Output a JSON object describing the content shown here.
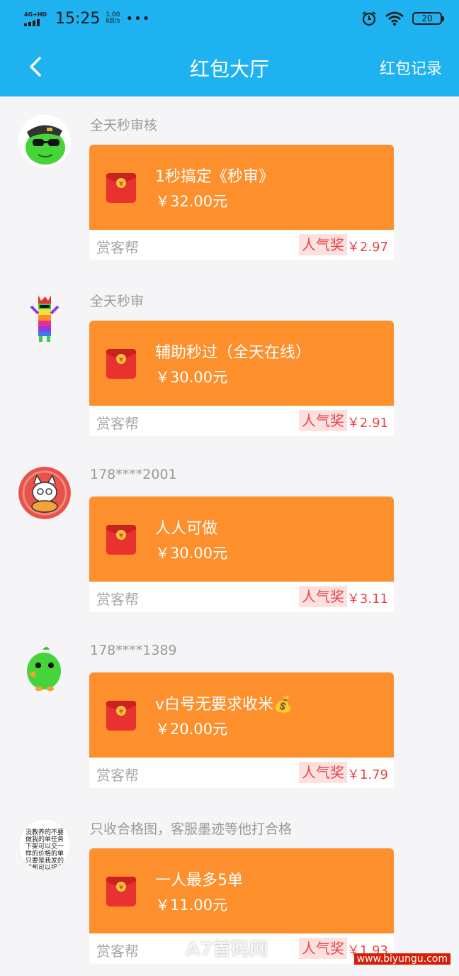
{
  "status_bar": {
    "network": "4G+HD",
    "time": "15:25",
    "speed_value": "1.00",
    "speed_unit": "KB/s",
    "more": "•••",
    "battery": "20"
  },
  "nav": {
    "title": "红包大厅",
    "record_label": "红包记录"
  },
  "items": [
    {
      "sender": "全天秒审核",
      "title": "1秒搞定《秒审》",
      "amount": "￥32.00元",
      "source": "赏客帮",
      "tag": "人气奖",
      "bonus": "￥2.97"
    },
    {
      "sender": "全天秒审",
      "title": "辅助秒过（全天在线）",
      "amount": "￥30.00元",
      "source": "赏客帮",
      "tag": "人气奖",
      "bonus": "￥2.91"
    },
    {
      "sender": "178****2001",
      "title": "人人可做",
      "amount": "￥30.00元",
      "source": "赏客帮",
      "tag": "人气奖",
      "bonus": "￥3.11"
    },
    {
      "sender": "178****1389",
      "title": "v白号无要求收米💰",
      "amount": "￥20.00元",
      "source": "赏客帮",
      "tag": "人气奖",
      "bonus": "￥1.79"
    },
    {
      "sender": "只收合格图，客服墨迹等他打合格",
      "title": "一人最多5单",
      "amount": "￥11.00元",
      "source": "赏客帮",
      "tag": "人气奖",
      "bonus": "￥1.93",
      "avatar_text": "没教养的不要做我的单任务下架可以交一样的价格的单只要是我发的群都可以提交"
    }
  ],
  "watermark": {
    "text": "A7首码网",
    "url": "www.biyungu.com"
  },
  "colors": {
    "header": "#1fb2f0",
    "card": "#fd8f2c",
    "envelope": "#e8322f",
    "accent": "#e84545"
  }
}
